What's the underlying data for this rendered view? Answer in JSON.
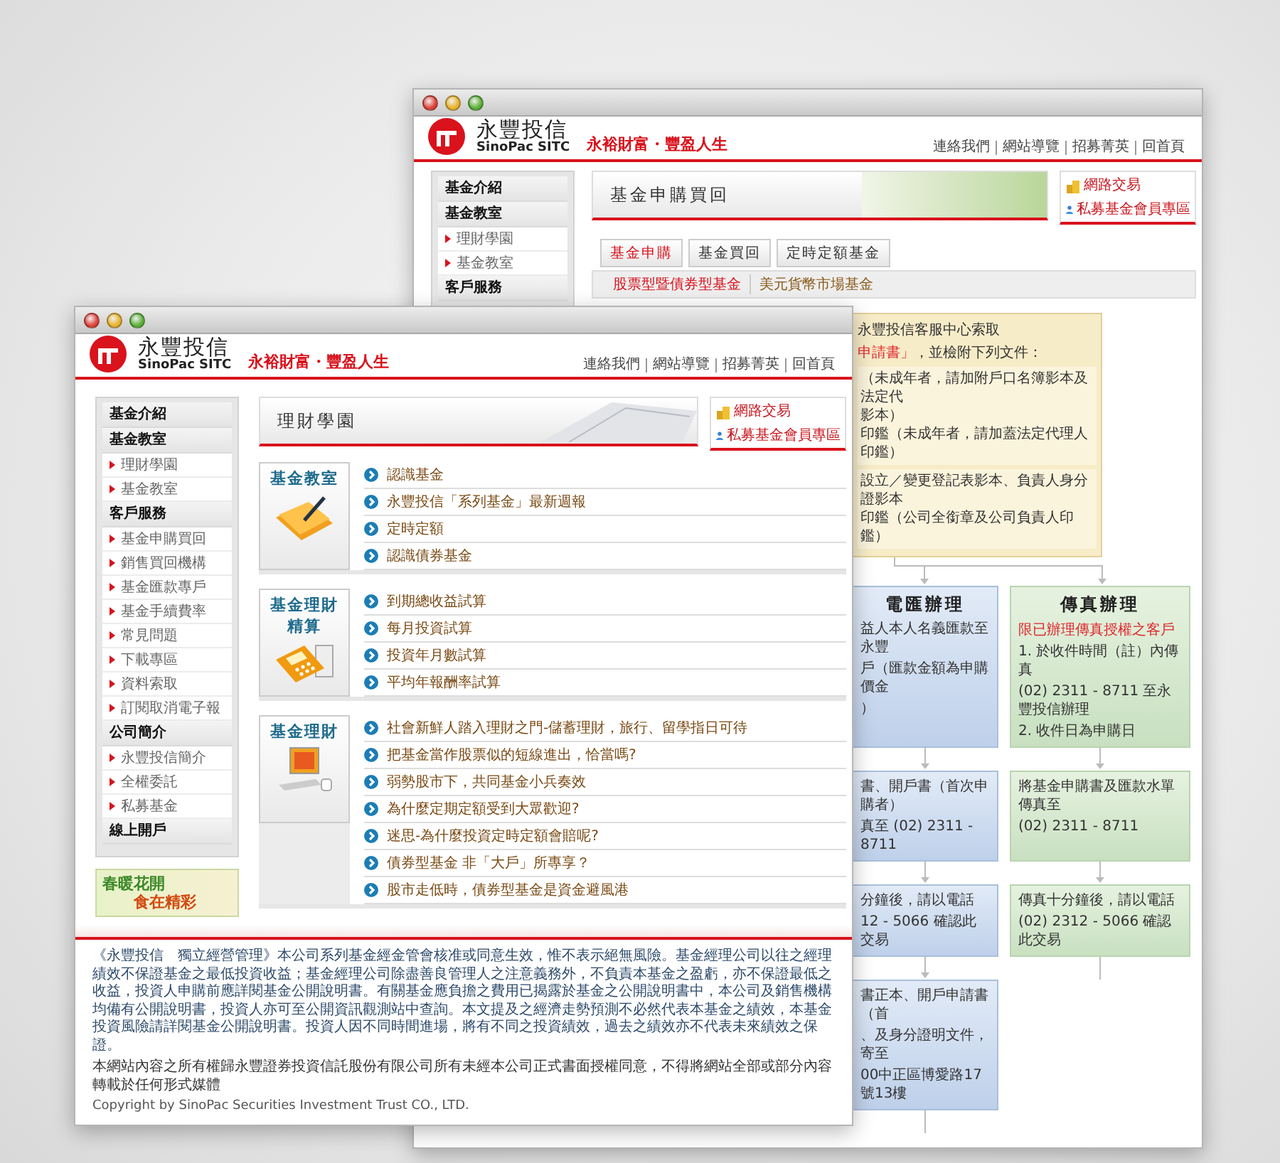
{
  "back_window": {
    "header": {
      "brand": "永豐投信",
      "brand_en": "SinoPac SITC",
      "slogan": "永裕財富・豐盈人生",
      "top_links": [
        "連絡我們",
        "網站導覽",
        "招募菁英",
        "回首頁"
      ]
    },
    "sidebar": [
      {
        "label": "基金介紹"
      },
      {
        "label": "基金教室",
        "children": [
          "理財學園",
          "基金教室"
        ]
      },
      {
        "label": "客戶服務"
      }
    ],
    "banner_title": "基金申購買回",
    "quick_links": [
      {
        "kind": "coins",
        "label": "網路交易"
      },
      {
        "kind": "member",
        "label": "私募基金會員專區"
      }
    ],
    "tabs": [
      {
        "label": "基金申購",
        "selected": true
      },
      {
        "label": "基金買回",
        "selected": false
      },
      {
        "label": "定時定額基金",
        "selected": false
      }
    ],
    "subtabs": [
      {
        "label": "股票型暨債券型基金",
        "selected": true
      },
      {
        "label": "美元貨幣市場基金",
        "selected": false
      }
    ],
    "flow": {
      "intro": [
        [
          {
            "text": "永豐投信客服中心索取",
            "highlight": false
          }
        ],
        [
          {
            "text": "申請書」",
            "highlight": true
          },
          {
            "text": "，並檢附下列文件：",
            "highlight": false
          }
        ]
      ],
      "groups": [
        [
          "（未成年者，請加附戶口名簿影本及法定代",
          "影本）",
          "印鑑（未成年者，請加蓋法定代理人印鑑）"
        ],
        [
          "設立／變更登記表影本、負責人身分證影本",
          "印鑑（公司全銜章及公司負責人印鑑）"
        ]
      ],
      "columns": [
        {
          "kind": "wire",
          "title": "電匯辦理",
          "steps": [
            [
              "益人本人名義匯款至永豐",
              "戶（匯款金額為申購價金",
              "）"
            ],
            [
              "書、開戶書（首次申購者）",
              "真至 (02) 2311 - 8711"
            ],
            [
              "分鐘後，請以電話",
              "12 - 5066 確認此交易"
            ],
            [
              "書正本、開戶申請書（首",
              "、及身分證明文件，寄至",
              "00中正區博愛路17號13樓"
            ]
          ]
        },
        {
          "kind": "fax",
          "title": "傳真辦理",
          "note": "限已辦理傳真授權之客戶",
          "steps": [
            [
              "1. 於收件時間（註）內傳真",
              "(02) 2311 - 8711 至永豐投信辦理",
              "2. 收件日為申購日"
            ],
            [
              "將基金申購書及匯款水單傳真至",
              "(02) 2311 - 8711"
            ],
            [
              "傳真十分鐘後，請以電話",
              "(02) 2312 - 5066 確認此交易"
            ]
          ]
        }
      ]
    }
  },
  "front_window": {
    "header": {
      "brand": "永豐投信",
      "brand_en": "SinoPac SITC",
      "slogan": "永裕財富・豐盈人生",
      "top_links": [
        "連絡我們",
        "網站導覽",
        "招募菁英",
        "回首頁"
      ]
    },
    "sidebar": [
      {
        "label": "基金介紹"
      },
      {
        "label": "基金教室",
        "children": [
          "理財學園",
          "基金教室"
        ]
      },
      {
        "label": "客戶服務",
        "children": [
          "基金申購買回",
          "銷售買回機構",
          "基金匯款專戶",
          "基金手續費率",
          "常見問題",
          "下載專區",
          "資料索取",
          "訂閱取消電子報"
        ]
      },
      {
        "label": "公司簡介",
        "children": [
          "永豐投信簡介",
          "全權委託",
          "私募基金"
        ]
      },
      {
        "label": "線上開戶"
      }
    ],
    "promo": [
      "春暖花開",
      "食在精彩"
    ],
    "banner_title": "理財學園",
    "quick_links": [
      {
        "kind": "coins",
        "label": "網路交易"
      },
      {
        "kind": "member",
        "label": "私募基金會員專區"
      }
    ],
    "sections": [
      {
        "kind": "notepad",
        "title": [
          "基金教室"
        ],
        "links": [
          "認識基金",
          "永豐投信「系列基金」最新週報",
          "定時定額",
          "認識債券基金"
        ]
      },
      {
        "kind": "calculator",
        "title": [
          "基金理財",
          "精算"
        ],
        "links": [
          "到期總收益試算",
          "每月投資試算",
          "投資年月數試算",
          "平均年報酬率試算"
        ]
      },
      {
        "kind": "computer",
        "title": [
          "基金理財"
        ],
        "links": [
          "社會新鮮人踏入理財之門-儲蓄理財，旅行、留學指日可待",
          "把基金當作股票似的短線進出，恰當嗎?",
          "弱勢股市下，共同基金小兵奏效",
          "為什麼定期定額受到大眾歡迎?",
          "迷思-為什麼投資定時定額會賠呢?",
          "債券型基金 非「大戶」所專享？",
          "股市走低時，債券型基金是資金避風港"
        ]
      }
    ],
    "footer": {
      "disclaimer": "《永豐投信　獨立經營管理》本公司系列基金經金管會核准或同意生效，惟不表示絕無風險。基金經理公司以往之經理績效不保證基金之最低投資收益；基金經理公司除盡善良管理人之注意義務外，不負責本基金之盈虧，亦不保證最低之收益，投資人申購前應詳閱基金公開說明書。有關基金應負擔之費用已揭露於基金之公開說明書中，本公司及銷售機構均備有公開說明書，投資人亦可至公開資訊觀測站中查詢。本文提及之經濟走勢預測不必然代表本基金之績效，本基金投資風險請詳閱基金公開說明書。投資人因不同時間進場，將有不同之投資績效，過去之績效亦不代表未來績效之保證。",
      "rights": "本網站內容之所有權歸永豐證券投資信託股份有限公司所有未經本公司正式書面授權同意，不得將網站全部或部分內容轉載於任何形式媒體",
      "copyright": "Copyright by SinoPac Securities Investment Trust CO., LTD."
    }
  }
}
